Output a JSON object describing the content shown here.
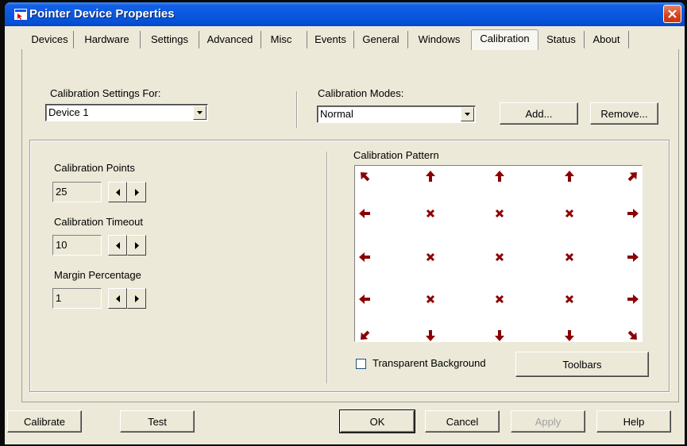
{
  "window": {
    "title": "Pointer Device Properties"
  },
  "tabs": [
    {
      "label": "Devices"
    },
    {
      "label": "Hardware"
    },
    {
      "label": "Settings"
    },
    {
      "label": "Advanced"
    },
    {
      "label": "Misc"
    },
    {
      "label": "Events"
    },
    {
      "label": "General"
    },
    {
      "label": "Windows"
    },
    {
      "label": "Calibration"
    },
    {
      "label": "Status"
    },
    {
      "label": "About"
    }
  ],
  "active_tab": "Calibration",
  "settings_for": {
    "label": "Calibration Settings For:",
    "value": "Device 1"
  },
  "modes": {
    "label": "Calibration Modes:",
    "value": "Normal",
    "add": "Add...",
    "remove": "Remove..."
  },
  "points": {
    "label": "Calibration Points",
    "value": "25"
  },
  "timeout": {
    "label": "Calibration Timeout",
    "value": "10"
  },
  "margin": {
    "label": "Margin Percentage",
    "value": "1"
  },
  "pattern": {
    "label": "Calibration Pattern",
    "color": "#8b0000",
    "grid": [
      [
        "arrow-up-left",
        "arrow-up",
        "arrow-up",
        "arrow-up",
        "arrow-up-right"
      ],
      [
        "arrow-left",
        "cross",
        "cross",
        "cross",
        "arrow-right"
      ],
      [
        "arrow-left",
        "cross",
        "cross",
        "cross",
        "arrow-right"
      ],
      [
        "arrow-left",
        "cross",
        "cross",
        "cross",
        "arrow-right"
      ],
      [
        "arrow-down-left",
        "arrow-down",
        "arrow-down",
        "arrow-down",
        "arrow-down-right"
      ]
    ]
  },
  "transparent_bg": {
    "label": "Transparent Background",
    "checked": false
  },
  "toolbars": "Toolbars",
  "footer": {
    "calibrate": "Calibrate",
    "test": "Test",
    "ok": "OK",
    "cancel": "Cancel",
    "apply": "Apply",
    "help": "Help"
  }
}
